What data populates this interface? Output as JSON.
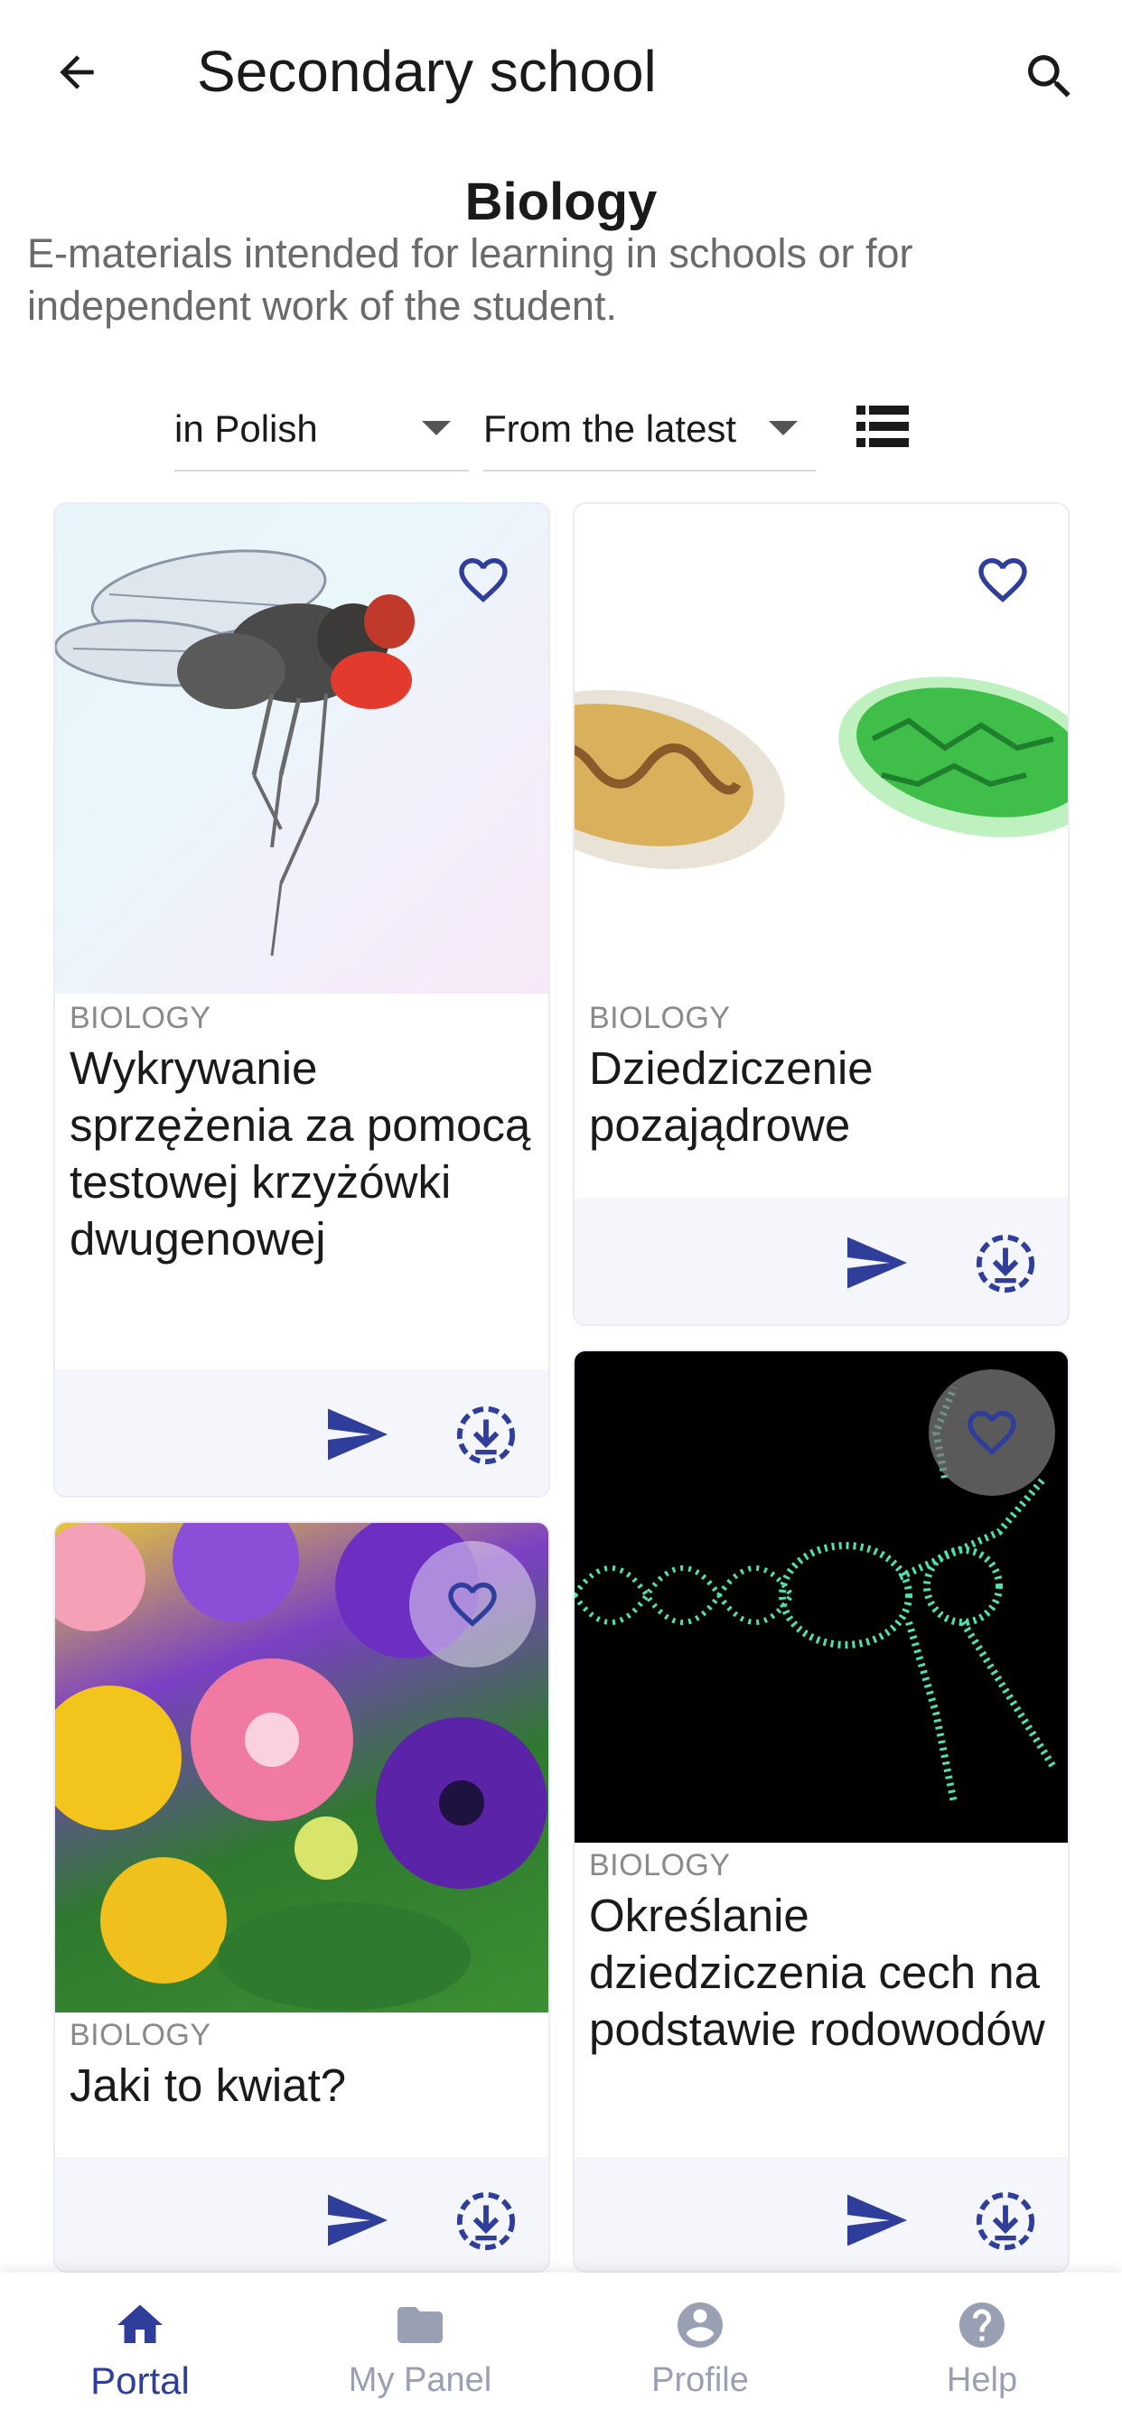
{
  "header": {
    "title": "Secondary school",
    "back_icon": "arrow-left-icon",
    "search_icon": "search-icon"
  },
  "section": {
    "title": "Biology",
    "description": "E-materials intended for learning in schools or for independent work of the student."
  },
  "filters": {
    "language": "in Polish",
    "sort": "From the latest",
    "view_toggle_icon": "list-view-icon"
  },
  "colors": {
    "accent": "#2f3d9b",
    "nav_inactive": "#9aa0b4",
    "card_footer": "#f5f6fb"
  },
  "cards": [
    {
      "subject": "BIOLOGY",
      "title": "Wykrywanie sprzężenia za pomocą testowej krzyżówki dwugenowej",
      "image": "fruit-fly-photo"
    },
    {
      "subject": "BIOLOGY",
      "title": "Dziedziczenie pozajądrowe",
      "image": "mitochondria-chloroplast-illustration"
    },
    {
      "subject": "BIOLOGY",
      "title": "Jaki to kwiat?",
      "image": "daisies-and-pansies-photo"
    },
    {
      "subject": "BIOLOGY",
      "title": "Określanie dziedziczenia cech na podstawie rodowodów",
      "image": "dna-human-figure-illustration"
    }
  ],
  "bottom_nav": {
    "items": [
      {
        "label": "Portal",
        "icon": "home-icon",
        "active": true
      },
      {
        "label": "My Panel",
        "icon": "folder-icon",
        "active": false
      },
      {
        "label": "Profile",
        "icon": "profile-icon",
        "active": false
      },
      {
        "label": "Help",
        "icon": "help-icon",
        "active": false
      }
    ]
  }
}
